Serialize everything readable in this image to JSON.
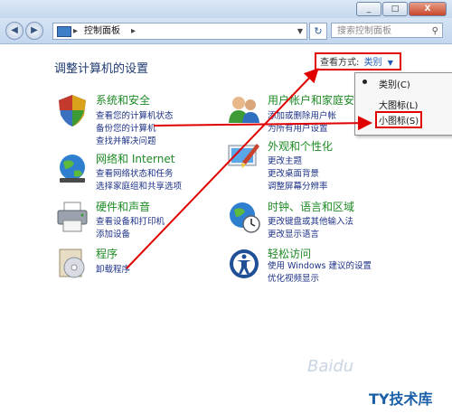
{
  "address": {
    "crumb": "控制面板",
    "search_placeholder": "搜索控制面板"
  },
  "window": {
    "minimize": "_",
    "maximize": "□",
    "close": "X"
  },
  "heading": "调整计算机的设置",
  "view_by": {
    "label": "查看方式:",
    "value": "类别"
  },
  "view_menu": {
    "category": "类别(C)",
    "large_icons": "大图标(L)",
    "small_icons": "小图标(S)"
  },
  "categories": [
    {
      "title": "系统和安全",
      "links": [
        "查看您的计算机状态",
        "备份您的计算机",
        "查找并解决问题"
      ],
      "icon": "shield-icon"
    },
    {
      "title": "网络和 Internet",
      "links": [
        "查看网络状态和任务",
        "选择家庭组和共享选项"
      ],
      "icon": "network-globe-icon"
    },
    {
      "title": "硬件和声音",
      "links": [
        "查看设备和打印机",
        "添加设备"
      ],
      "icon": "printer-icon"
    },
    {
      "title": "程序",
      "links": [
        "卸载程序"
      ],
      "icon": "programs-icon"
    },
    {
      "title": "用户帐户和家庭安",
      "links": [
        "添加或删除用户帐",
        "为所有用户设置"
      ],
      "icon": "users-icon"
    },
    {
      "title": "外观和个性化",
      "links": [
        "更改主题",
        "更改桌面背景",
        "调整屏幕分辨率"
      ],
      "icon": "paint-icon"
    },
    {
      "title": "时钟、语言和区域",
      "links": [
        "更改键盘或其他输入法",
        "更改显示语言"
      ],
      "icon": "clock-globe-icon"
    },
    {
      "title": "轻松访问",
      "links": [
        "使用 Windows 建议的设置",
        "优化视频显示"
      ],
      "icon": "accessibility-icon"
    }
  ],
  "watermark": {
    "text": "Baidu",
    "brand": "TY技术库"
  },
  "colors": {
    "link": "#1e3287",
    "category_title": "#1d8a24",
    "highlight_red": "#e00000"
  }
}
